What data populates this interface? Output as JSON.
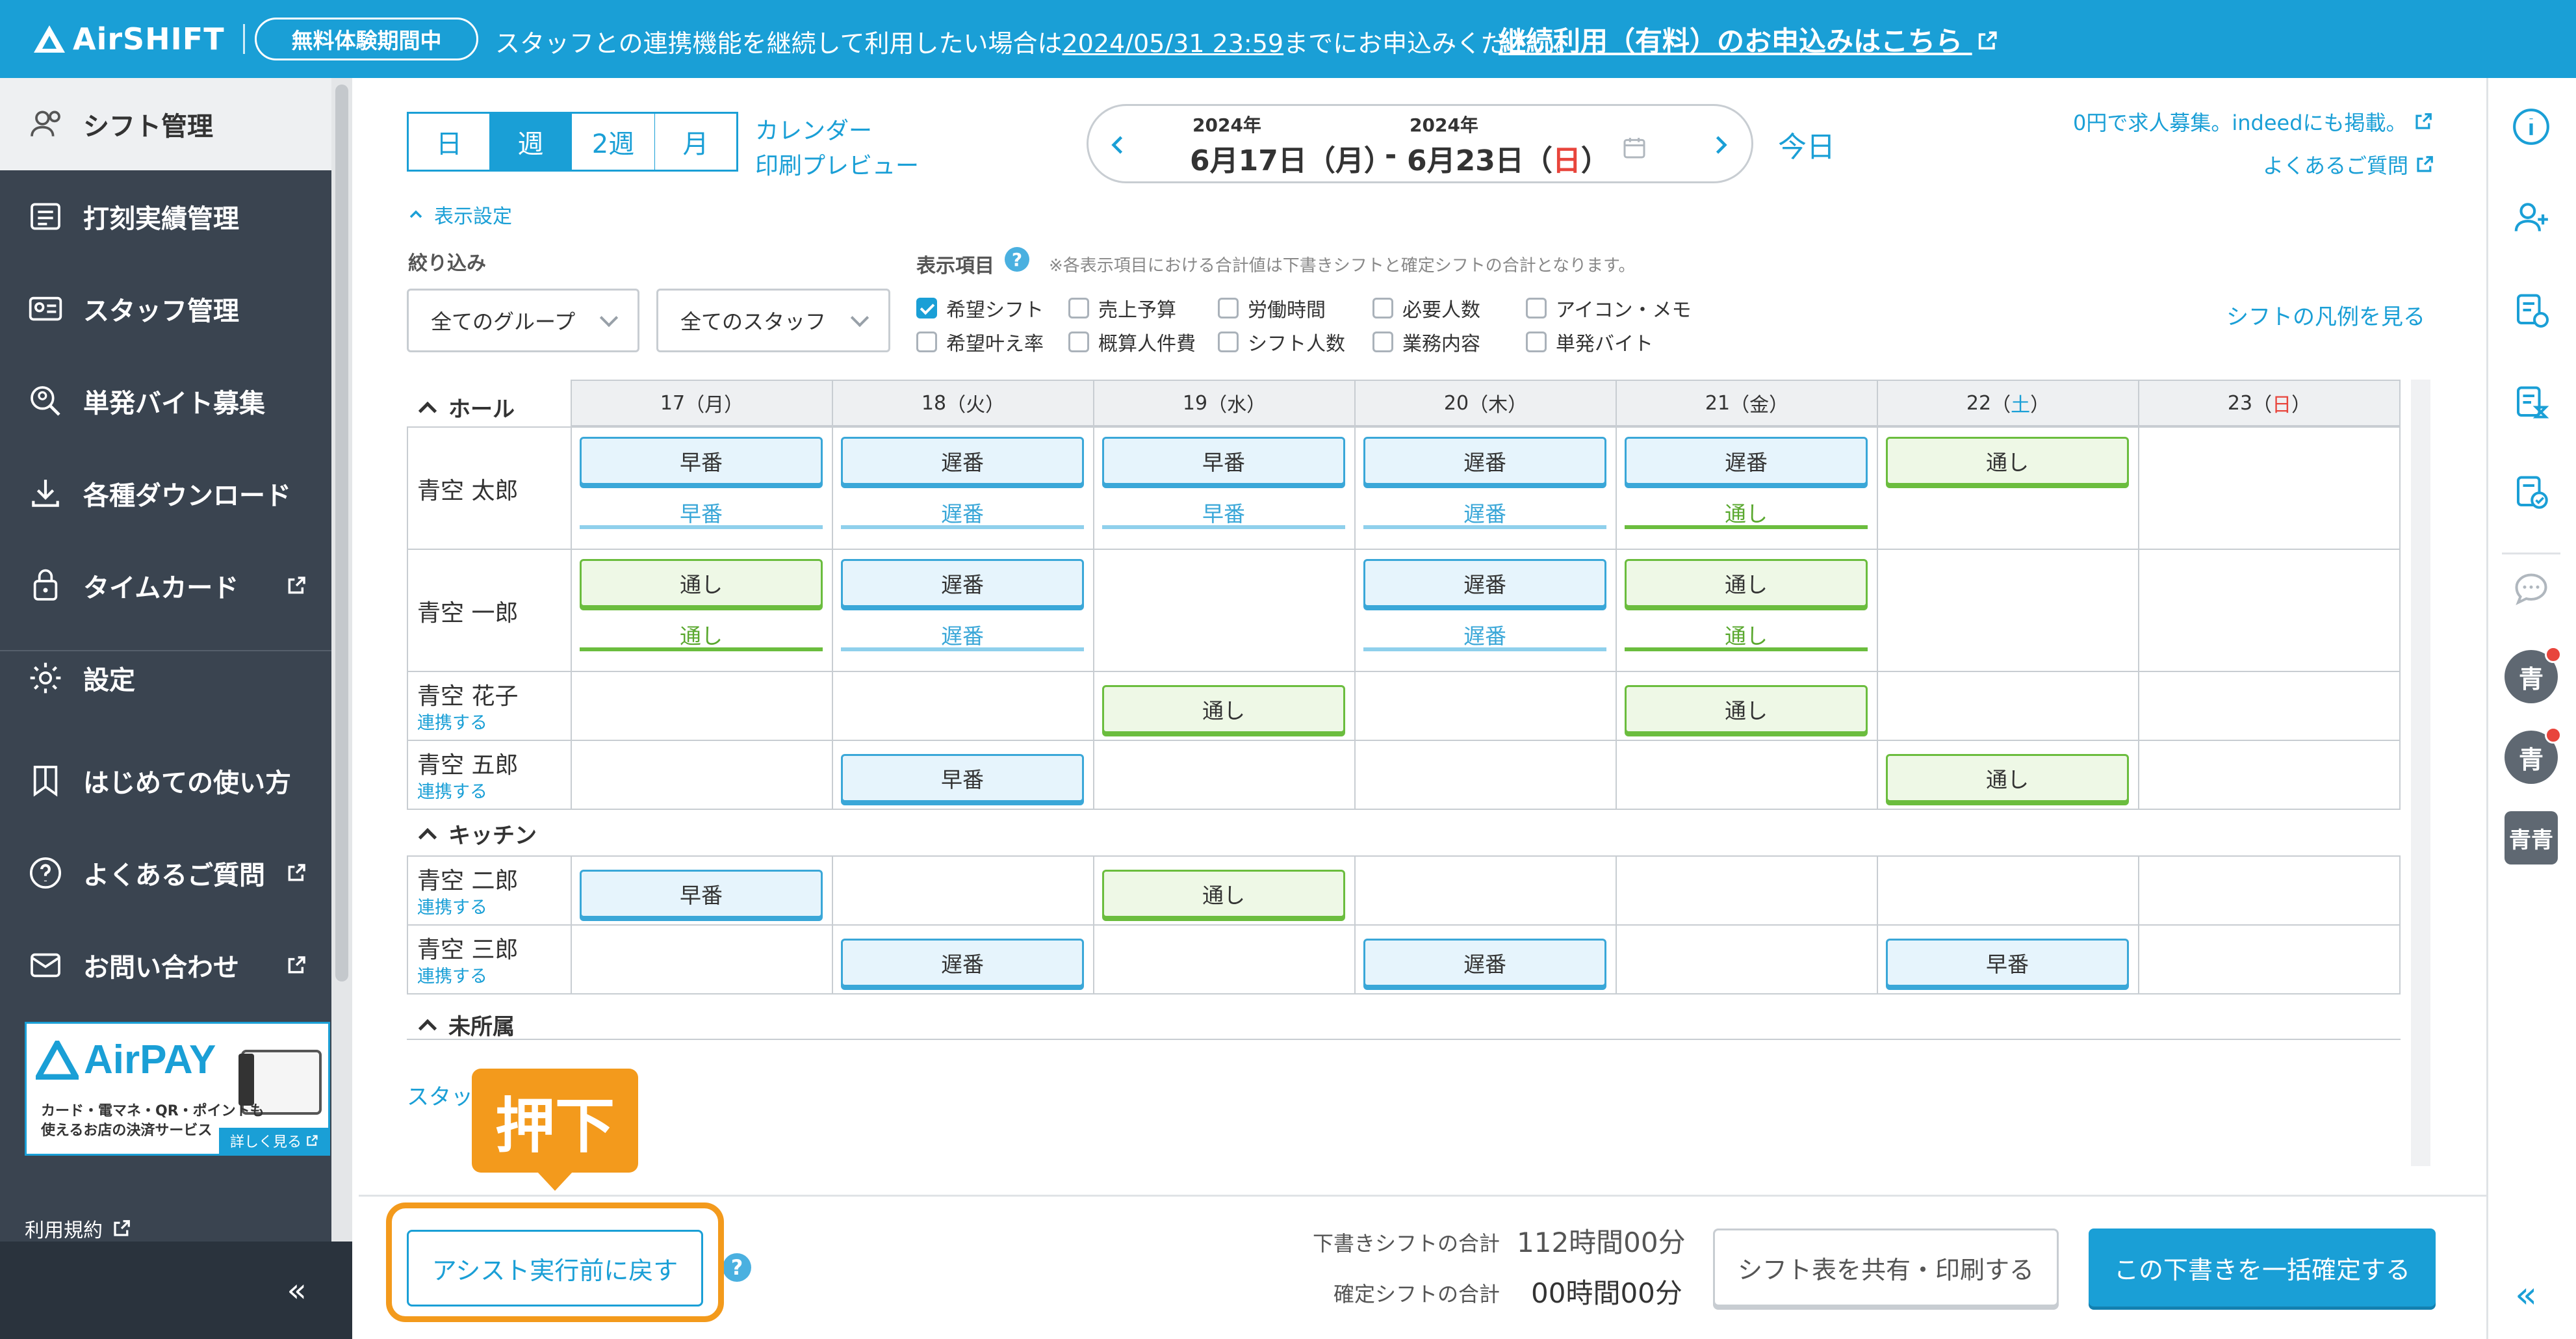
{
  "banner": {
    "logo": "AirSHIFT",
    "trial_badge": "無料体験期間中",
    "message_pre": "スタッフとの連携機能を継続して利用したい場合は",
    "message_deadline": "2024/05/31 23:59",
    "message_post": "までにお申込みください。",
    "cta_link": "継続利用（有料）のお申込みはこちら"
  },
  "sidebar": {
    "items": [
      {
        "label": "シフト管理",
        "icon": "shift-users-icon",
        "external": false,
        "active": true
      },
      {
        "label": "打刻実績管理",
        "icon": "timecard-list-icon",
        "external": false,
        "active": false
      },
      {
        "label": "スタッフ管理",
        "icon": "staff-id-card-icon",
        "external": false,
        "active": false
      },
      {
        "label": "単発バイト募集",
        "icon": "search-person-icon",
        "external": false,
        "active": false
      },
      {
        "label": "各種ダウンロード",
        "icon": "download-icon",
        "external": false,
        "active": false
      },
      {
        "label": "タイムカード",
        "icon": "timecard-lock-icon",
        "external": true,
        "active": false
      },
      {
        "label": "設定",
        "icon": "gear-icon",
        "external": false,
        "active": false
      },
      {
        "label": "はじめての使い方",
        "icon": "guide-flag-icon",
        "external": false,
        "active": false
      },
      {
        "label": "よくあるご質問",
        "icon": "question-icon",
        "external": true,
        "active": false
      },
      {
        "label": "お問い合わせ",
        "icon": "mail-icon",
        "external": true,
        "active": false
      }
    ],
    "ad": {
      "brand": "AirPAY",
      "line1": "カード・電マネ・QR・ポイントも",
      "line2": "使えるお店の決済サービス",
      "more": "詳しく見る"
    },
    "terms": "利用規約",
    "collapse": "«"
  },
  "toolbar": {
    "view_tabs": [
      "日",
      "週",
      "2週",
      "月"
    ],
    "active_tab": "週",
    "calendar_link": "カレンダー",
    "print_link": "印刷プレビュー",
    "range_start_year": "2024年",
    "range_start": "6月17日（月）",
    "range_sep": "-",
    "range_end_year": "2024年",
    "range_end_pre": "6月23日（",
    "range_end_day": "日",
    "range_end_post": "）",
    "today": "今日",
    "recruit_link": "0円で求人募集。indeedにも掲載。",
    "faq_link": "よくあるご質問"
  },
  "settings": {
    "toggle": "表示設定",
    "filter_label": "絞り込み",
    "group_select": "全てのグループ",
    "staff_select": "全てのスタッフ",
    "items_label": "表示項目",
    "items_note": "※各表示項目における合計値は下書きシフトと確定シフトの合計となります。",
    "checkboxes": [
      {
        "label": "希望シフト",
        "checked": true
      },
      {
        "label": "売上予算",
        "checked": false
      },
      {
        "label": "労働時間",
        "checked": false
      },
      {
        "label": "必要人数",
        "checked": false
      },
      {
        "label": "アイコン・メモ",
        "checked": false
      },
      {
        "label": "希望叶え率",
        "checked": false
      },
      {
        "label": "概算人件費",
        "checked": false
      },
      {
        "label": "シフト人数",
        "checked": false
      },
      {
        "label": "業務内容",
        "checked": false
      },
      {
        "label": "単発バイト",
        "checked": false
      }
    ],
    "legend_link": "シフトの凡例を見る"
  },
  "grid": {
    "days": [
      {
        "num": "17",
        "wd": "月",
        "color": "#333333"
      },
      {
        "num": "18",
        "wd": "火",
        "color": "#333333"
      },
      {
        "num": "19",
        "wd": "水",
        "color": "#333333"
      },
      {
        "num": "20",
        "wd": "木",
        "color": "#333333"
      },
      {
        "num": "21",
        "wd": "金",
        "color": "#333333"
      },
      {
        "num": "22",
        "wd": "土",
        "color": "#1a9fd6"
      },
      {
        "num": "23",
        "wd": "日",
        "color": "#e8453c"
      }
    ],
    "groups": [
      "ホール",
      "キッチン",
      "未所属"
    ],
    "link_label": "連携する",
    "rows": [
      {
        "name": "青空 太郎",
        "link": false,
        "shifts": [
          [
            "早番",
            "b"
          ],
          [
            "遅番",
            "b"
          ],
          [
            "早番",
            "b"
          ],
          [
            "遅番",
            "b"
          ],
          [
            "遅番",
            "b"
          ],
          [
            "通し",
            "g"
          ],
          null
        ],
        "hopes": [
          [
            "早番",
            "b"
          ],
          [
            "遅番",
            "b"
          ],
          [
            "早番",
            "b"
          ],
          [
            "遅番",
            "b"
          ],
          [
            "通し",
            "g"
          ],
          null,
          null
        ]
      },
      {
        "name": "青空 一郎",
        "link": false,
        "shifts": [
          [
            "通し",
            "g"
          ],
          [
            "遅番",
            "b"
          ],
          null,
          [
            "遅番",
            "b"
          ],
          [
            "通し",
            "g"
          ],
          null,
          null
        ],
        "hopes": [
          [
            "通し",
            "g"
          ],
          [
            "遅番",
            "b"
          ],
          null,
          [
            "遅番",
            "b"
          ],
          [
            "通し",
            "g"
          ],
          null,
          null
        ]
      },
      {
        "name": "青空 花子",
        "link": true,
        "shifts": [
          null,
          null,
          [
            "通し",
            "g"
          ],
          null,
          [
            "通し",
            "g"
          ],
          null,
          null
        ]
      },
      {
        "name": "青空 五郎",
        "link": true,
        "shifts": [
          null,
          [
            "早番",
            "b"
          ],
          null,
          null,
          null,
          [
            "通し",
            "g"
          ],
          null
        ]
      },
      {
        "name": "青空 二郎",
        "link": true,
        "shifts": [
          [
            "早番",
            "b"
          ],
          null,
          [
            "通し",
            "g"
          ],
          null,
          null,
          null,
          null
        ]
      },
      {
        "name": "青空 三郎",
        "link": true,
        "shifts": [
          null,
          [
            "遅番",
            "b"
          ],
          null,
          [
            "遅番",
            "b"
          ],
          null,
          [
            "早番",
            "b"
          ],
          null
        ]
      }
    ],
    "staff_partial": "スタッ"
  },
  "bottom": {
    "revert_button": "アシスト実行前に戻す",
    "draft_total_label": "下書きシフトの合計",
    "draft_total_value": "112時間00分",
    "confirmed_total_label": "確定シフトの合計",
    "confirmed_total_value": "00時間00分",
    "share_button": "シフト表を共有・印刷する",
    "confirm_button": "この下書きを一括確定する"
  },
  "callout": "押下",
  "rail": {
    "avatars": [
      "青",
      "青",
      "青青"
    ]
  },
  "colors": {
    "brand": "#1a9fd6",
    "sidebar": "#3a4450",
    "callout": "#f39a1c",
    "sunday": "#e8453c"
  }
}
